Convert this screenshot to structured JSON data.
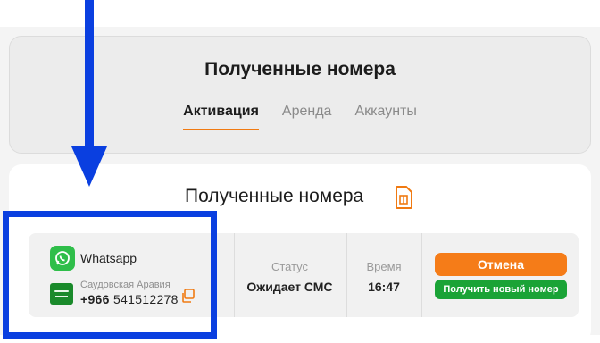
{
  "header": {
    "title": "Полученные номера",
    "tabs": [
      {
        "label": "Активация",
        "active": true
      },
      {
        "label": "Аренда",
        "active": false
      },
      {
        "label": "Аккаунты",
        "active": false
      }
    ]
  },
  "main": {
    "title": "Полученные номера",
    "title_icon": "sim-card-icon"
  },
  "order": {
    "service": {
      "name": "Whatsapp",
      "icon": "whatsapp-icon"
    },
    "country": {
      "name": "Саудовская Аравия",
      "flag": "saudi-flag-icon"
    },
    "phone": {
      "prefix": "+966",
      "number": "541512278"
    },
    "status": {
      "label": "Статус",
      "value": "Ожидает СМС"
    },
    "time": {
      "label": "Время",
      "value": "16:47"
    },
    "actions": {
      "cancel": "Отмена",
      "new_number": "Получить новый номер"
    }
  },
  "colors": {
    "accent_orange": "#f57c18",
    "accent_green": "#1aa336",
    "annotation_blue": "#0a3fe0",
    "whatsapp_green": "#2fbe4a"
  }
}
